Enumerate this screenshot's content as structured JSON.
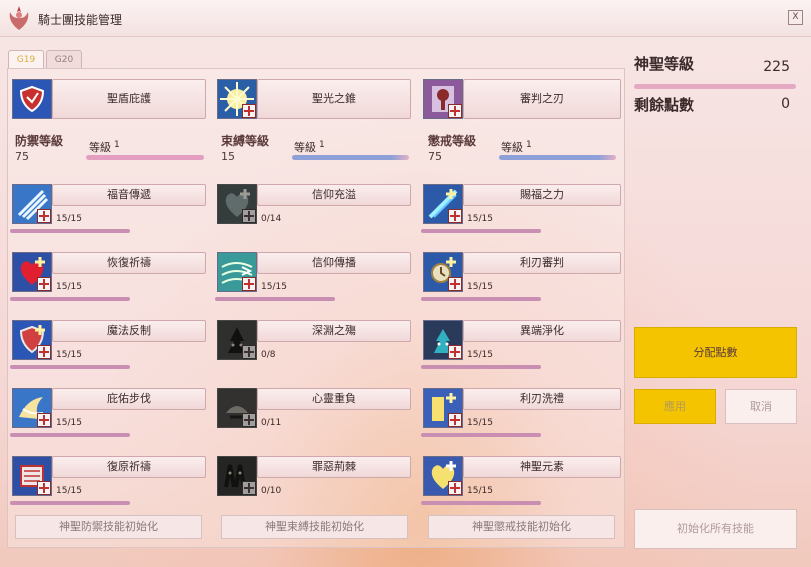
{
  "window": {
    "title": "騎士團技能管理",
    "close_label": "X"
  },
  "tabs": [
    {
      "label": "G19",
      "active": true
    },
    {
      "label": "G20",
      "active": false
    }
  ],
  "top_skills": [
    {
      "name": "聖盾庇護",
      "icon": "holy-shield-icon"
    },
    {
      "name": "聖光之錐",
      "icon": "holy-light-cone-icon"
    },
    {
      "name": "審判之刃",
      "icon": "judgment-blade-icon"
    }
  ],
  "categories": [
    {
      "name": "防禦等級",
      "value": "75",
      "grade_label": "等級",
      "grade": "1"
    },
    {
      "name": "束縛等級",
      "value": "15",
      "grade_label": "等級",
      "grade": "1"
    },
    {
      "name": "懲戒等級",
      "value": "75",
      "grade_label": "等級",
      "grade": "1"
    }
  ],
  "skills": {
    "defense": [
      {
        "name": "福音傳遞",
        "count": "15/15",
        "icon": "gospel-icon"
      },
      {
        "name": "恢復祈禱",
        "count": "15/15",
        "icon": "heart-heal-icon"
      },
      {
        "name": "魔法反制",
        "count": "15/15",
        "icon": "magic-counter-icon"
      },
      {
        "name": "庇佑步伐",
        "count": "15/15",
        "icon": "blessed-step-icon"
      },
      {
        "name": "復原祈禱",
        "count": "15/15",
        "icon": "restore-prayer-icon"
      }
    ],
    "bind": [
      {
        "name": "信仰充溢",
        "count": "0/14",
        "icon": "faith-overflow-icon"
      },
      {
        "name": "信仰傳播",
        "count": "15/15",
        "icon": "faith-spread-icon"
      },
      {
        "name": "深淵之殤",
        "count": "0/8",
        "icon": "abyss-icon"
      },
      {
        "name": "心靈重負",
        "count": "0/11",
        "icon": "mind-burden-icon"
      },
      {
        "name": "罪惡荊棘",
        "count": "0/10",
        "icon": "sin-thorn-icon"
      }
    ],
    "punish": [
      {
        "name": "賜福之力",
        "count": "15/15",
        "icon": "blessing-power-icon"
      },
      {
        "name": "利刃審判",
        "count": "15/15",
        "icon": "blade-judgment-icon"
      },
      {
        "name": "異端淨化",
        "count": "15/15",
        "icon": "heretic-purge-icon"
      },
      {
        "name": "利刃洗禮",
        "count": "15/15",
        "icon": "blade-baptism-icon"
      },
      {
        "name": "神聖元素",
        "count": "15/15",
        "icon": "holy-element-icon"
      }
    ]
  },
  "reset_buttons": [
    "神聖防禦技能初始化",
    "神聖束縛技能初始化",
    "神聖懲戒技能初始化"
  ],
  "right_panel": {
    "holy_level_label": "神聖等級",
    "holy_level": "225",
    "remaining_points_label": "剩餘點數",
    "remaining_points": "0",
    "assign_label": "分配點數",
    "apply_label": "應用",
    "cancel_label": "取消",
    "reset_all_label": "初始化所有技能"
  },
  "colors": {
    "accent": "#f5c400",
    "bar_pink": "#c98fb3",
    "bar_blue": "#8ea0d8"
  }
}
